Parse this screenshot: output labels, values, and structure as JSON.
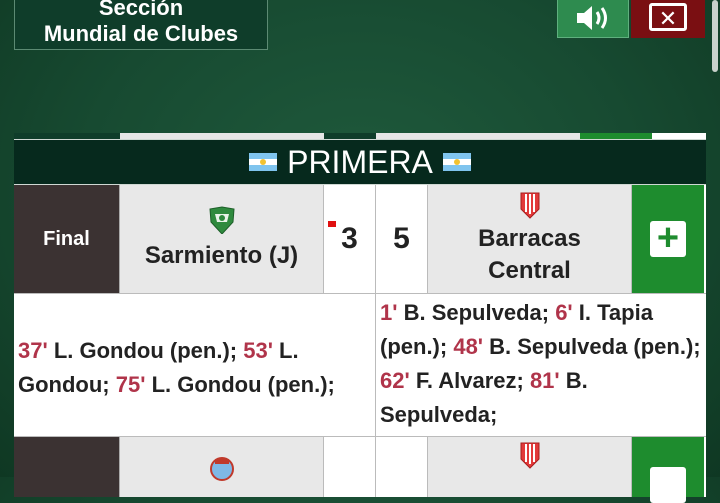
{
  "header": {
    "section_line1": "Sección",
    "section_line2": "Mundial de Clubes"
  },
  "league": {
    "title": "PRIMERA"
  },
  "colors": {
    "minute": "#b0344a",
    "plus_green": "#1e8c2e",
    "header_bg": "#06291d",
    "close_red": "#7a0f12"
  },
  "matches": [
    {
      "status": "Final",
      "home": {
        "name": "Sarmiento (J)",
        "score": "3",
        "crest": "sarmiento-crest"
      },
      "away": {
        "name_line1": "Barracas",
        "name_line2": "Central",
        "score": "5",
        "crest": "barracas-crest"
      },
      "home_goals": [
        {
          "minute": "37'",
          "text": " L. Gondou (pen.); "
        },
        {
          "minute": "53'",
          "text": " L. Gondou; "
        },
        {
          "minute": "75'",
          "text": " L. Gondou (pen.);"
        }
      ],
      "away_goals": [
        {
          "minute": "1'",
          "text": " B. Sepulveda; "
        },
        {
          "minute": "6'",
          "text": " I. Tapia (pen.); "
        },
        {
          "minute": "48'",
          "text": " B. Sepulveda (pen.); "
        },
        {
          "minute": "62'",
          "text": " F. Alvarez; "
        },
        {
          "minute": "81'",
          "text": " B. Sepulveda;"
        }
      ]
    }
  ]
}
